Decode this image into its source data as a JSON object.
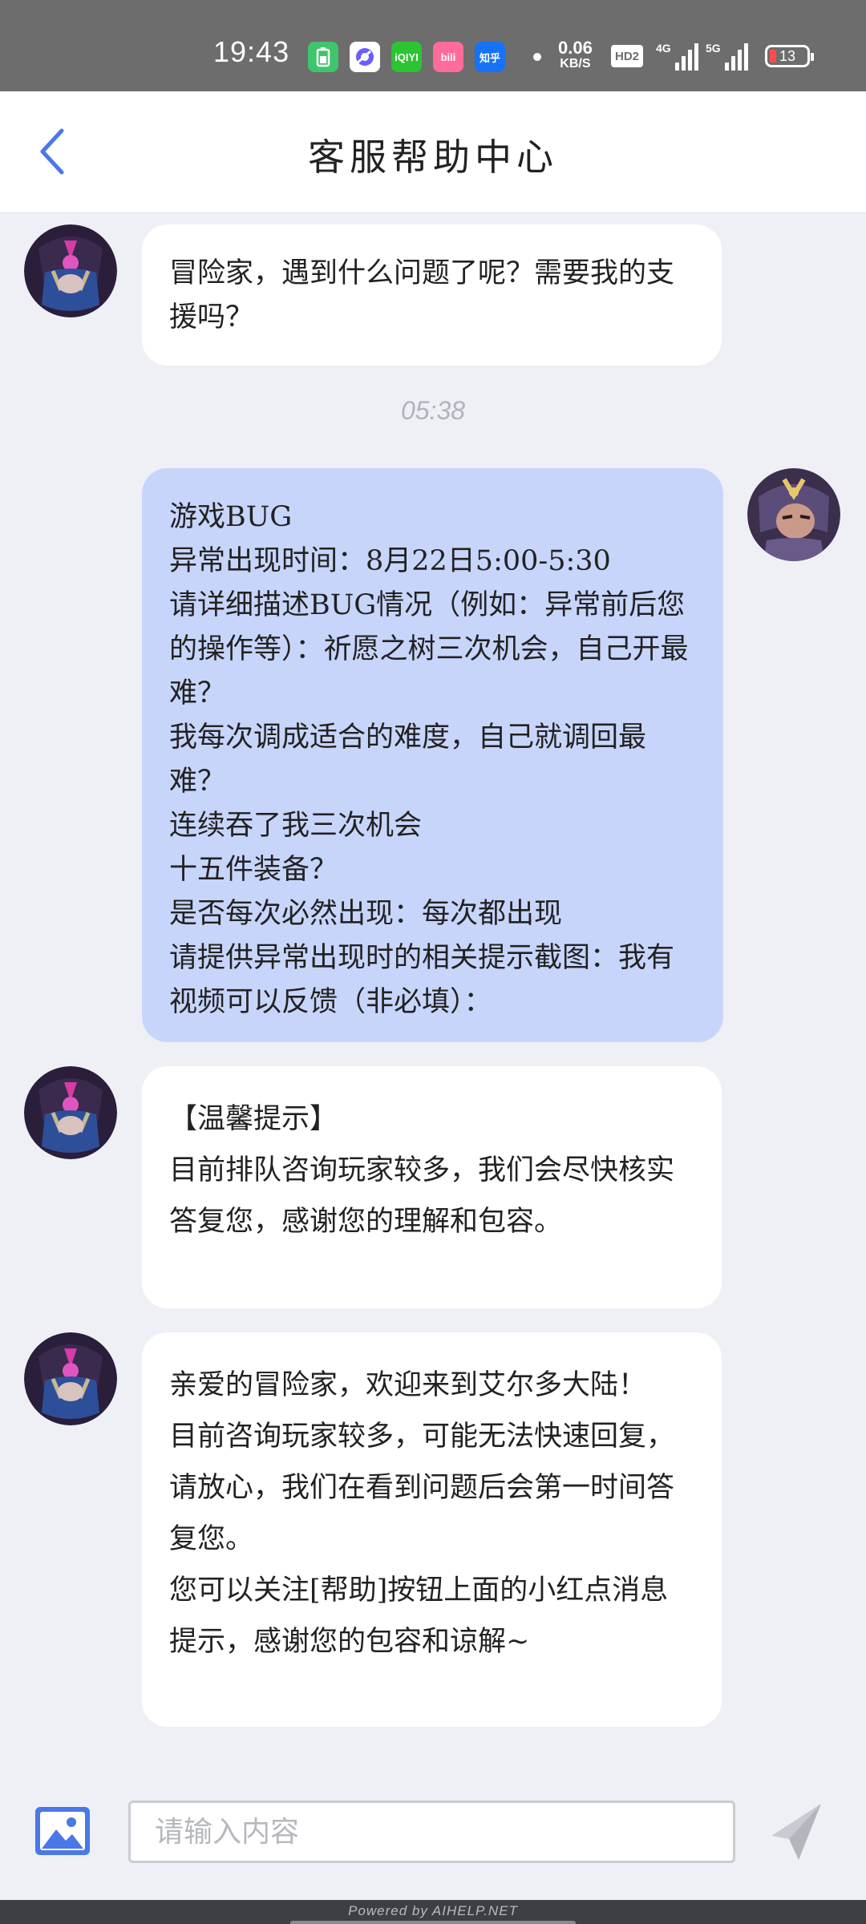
{
  "status_bar": {
    "time": "19:43",
    "apps": [
      {
        "name": "battery-saver-app-icon",
        "label": "",
        "color": "#3fc56b"
      },
      {
        "name": "browser-app-icon",
        "label": "",
        "color": "#ffffff"
      },
      {
        "name": "iqiyi-app-icon",
        "label": "iQIYI",
        "color": "#2cc532"
      },
      {
        "name": "bilibili-app-icon",
        "label": "bili",
        "color": "#ff6b9a"
      },
      {
        "name": "zhihu-app-icon",
        "label": "知乎",
        "color": "#1772f6"
      }
    ],
    "net_speed": "0.06",
    "net_speed_unit": "KB/S",
    "hd_label": "HD2",
    "signal_1_label": "4G",
    "signal_2_label": "5G",
    "battery": "13"
  },
  "header": {
    "title": "客服帮助中心"
  },
  "messages": [
    {
      "sender": "agent",
      "text": "冒险家，遇到什么问题了呢？需要我的支援吗？"
    },
    {
      "timestamp": "05:38"
    },
    {
      "sender": "user",
      "text": "游戏BUG\n异常出现时间：8月22日5:00-5:30\n请详细描述BUG情况（例如：异常前后您的操作等）：祈愿之树三次机会，自己开最难？\n我每次调成适合的难度，自己就调回最难？\n连续吞了我三次机会\n十五件装备？\n是否每次必然出现：每次都出现\n请提供异常出现时的相关提示截图：我有视频可以反馈（非必填）："
    },
    {
      "sender": "agent",
      "text": "【温馨提示】\n目前排队咨询玩家较多，我们会尽快核实答复您，感谢您的理解和包容。"
    },
    {
      "sender": "agent",
      "text": "亲爱的冒险家，欢迎来到艾尔多大陆！\n目前咨询玩家较多，可能无法快速回复，请放心，我们在看到问题后会第一时间答复您。\n您可以关注[帮助]按钮上面的小红点消息提示，感谢您的包容和谅解~"
    }
  ],
  "input": {
    "placeholder": "请输入内容",
    "value": ""
  },
  "footer": {
    "powered_by": "Powered by AIHELP.NET"
  },
  "colors": {
    "accent": "#4a78e8",
    "user_bubble": "#c8d5fb",
    "agent_bubble": "#ffffff",
    "background": "#eef0f5"
  }
}
